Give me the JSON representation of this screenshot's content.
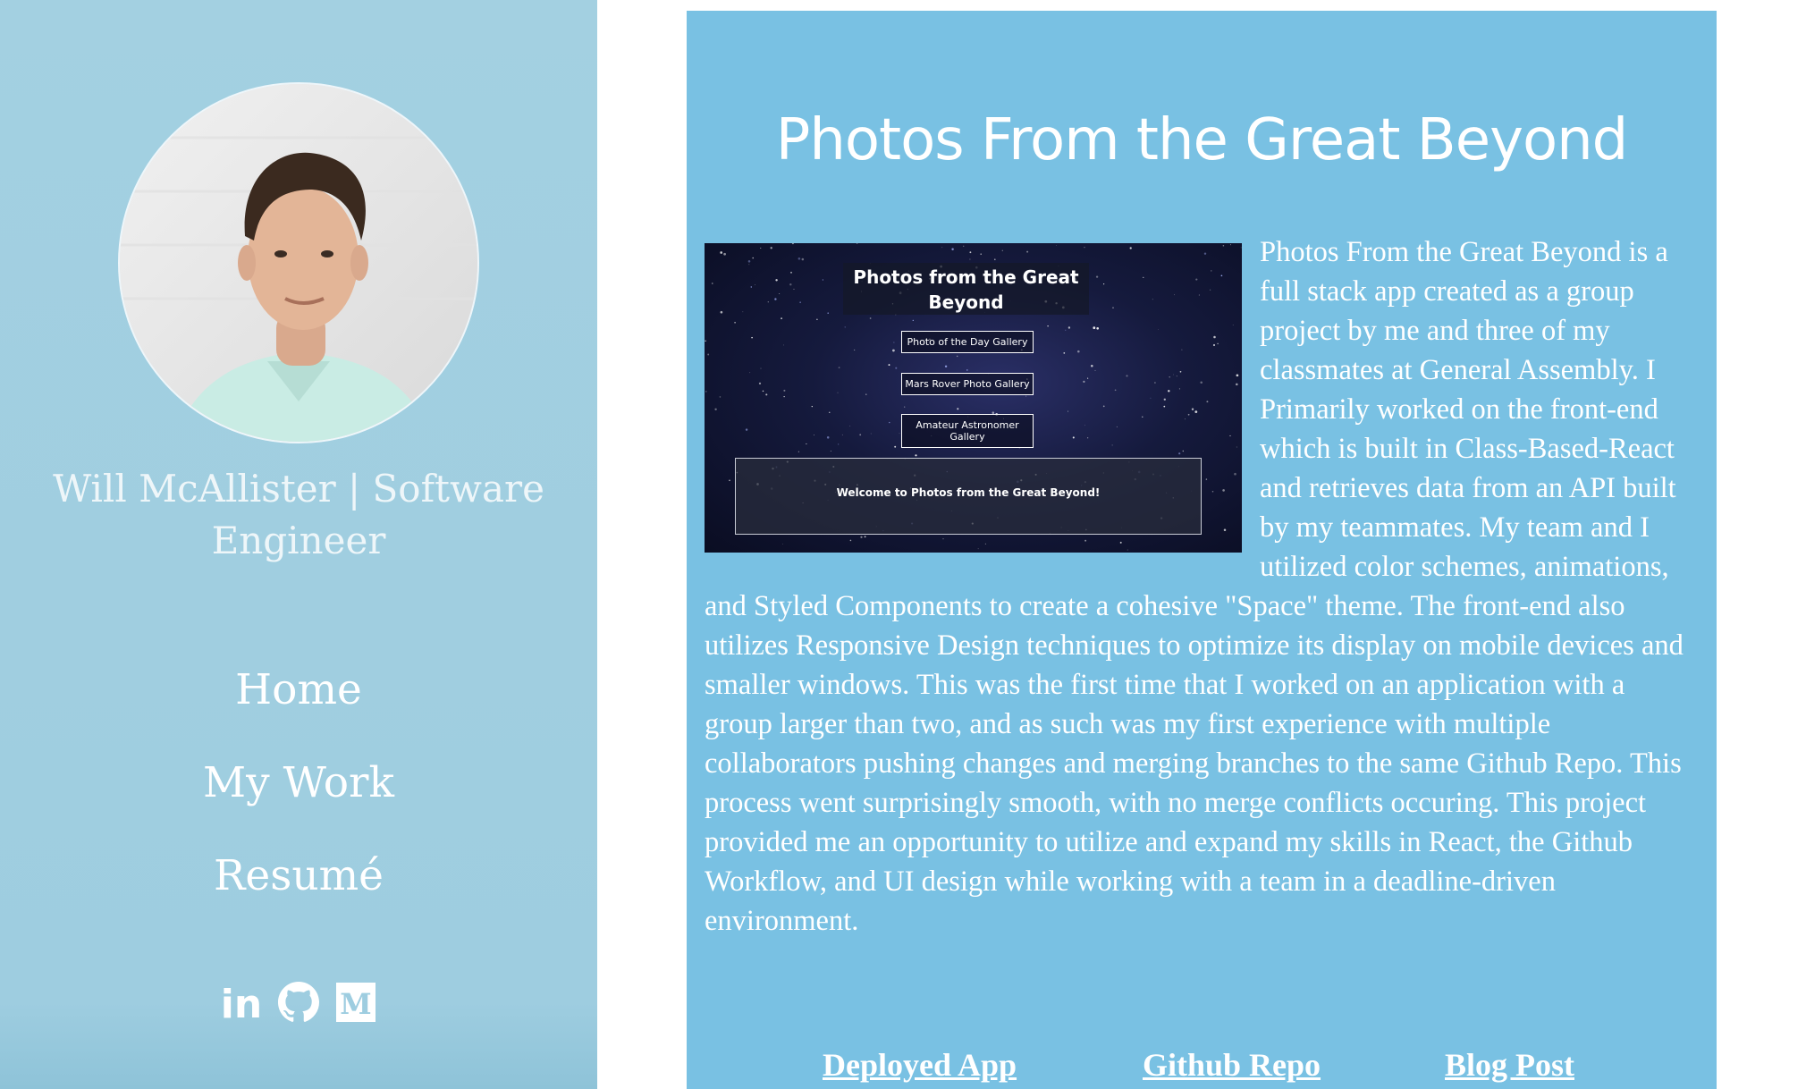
{
  "sidebar": {
    "site_title": "Will McAllister | Software Engineer",
    "nav": [
      {
        "label": "Home"
      },
      {
        "label": "My Work"
      },
      {
        "label": "Resumé"
      }
    ],
    "socials": [
      {
        "icon": "linkedin-icon",
        "label": "in"
      },
      {
        "icon": "github-icon"
      },
      {
        "icon": "medium-icon",
        "label": "M"
      }
    ],
    "colors": {
      "background": "#a3d0e1",
      "text": "#ffffff"
    }
  },
  "project": {
    "title": "Photos From the Great Beyond",
    "description": "Photos From the Great Beyond is a full stack app created as a group project by me and three of my classmates at General Assembly. I Primarily worked on the front-end which is built in Class-Based-React and retrieves data from an API built by my teammates. My team and I utilized color schemes, animations, and Styled Components to create a cohesive \"Space\" theme. The front-end also utilizes Responsive Design techniques to optimize its display on mobile devices and smaller windows. This was the first time that I worked on an application with a group larger than two, and as such was my first experience with multiple collaborators pushing changes and merging branches to the same Github Repo. This process went surprisingly smooth, with no merge conflicts occuring. This project provided me an opportunity to utilize and expand my skills in React, the Github Workflow, and UI design while working with a team in a deadline-driven environment.",
    "screenshot": {
      "title": "Photos from the Great Beyond",
      "buttons": [
        "Photo of the Day Gallery",
        "Mars Rover Photo Gallery",
        "Amateur Astronomer Gallery"
      ],
      "welcome": "Welcome to Photos from the Great Beyond!"
    },
    "links": [
      "Deployed App",
      "Github Repo",
      "Blog Post"
    ],
    "colors": {
      "card": "#79c1e3",
      "text": "#ffffff"
    }
  }
}
